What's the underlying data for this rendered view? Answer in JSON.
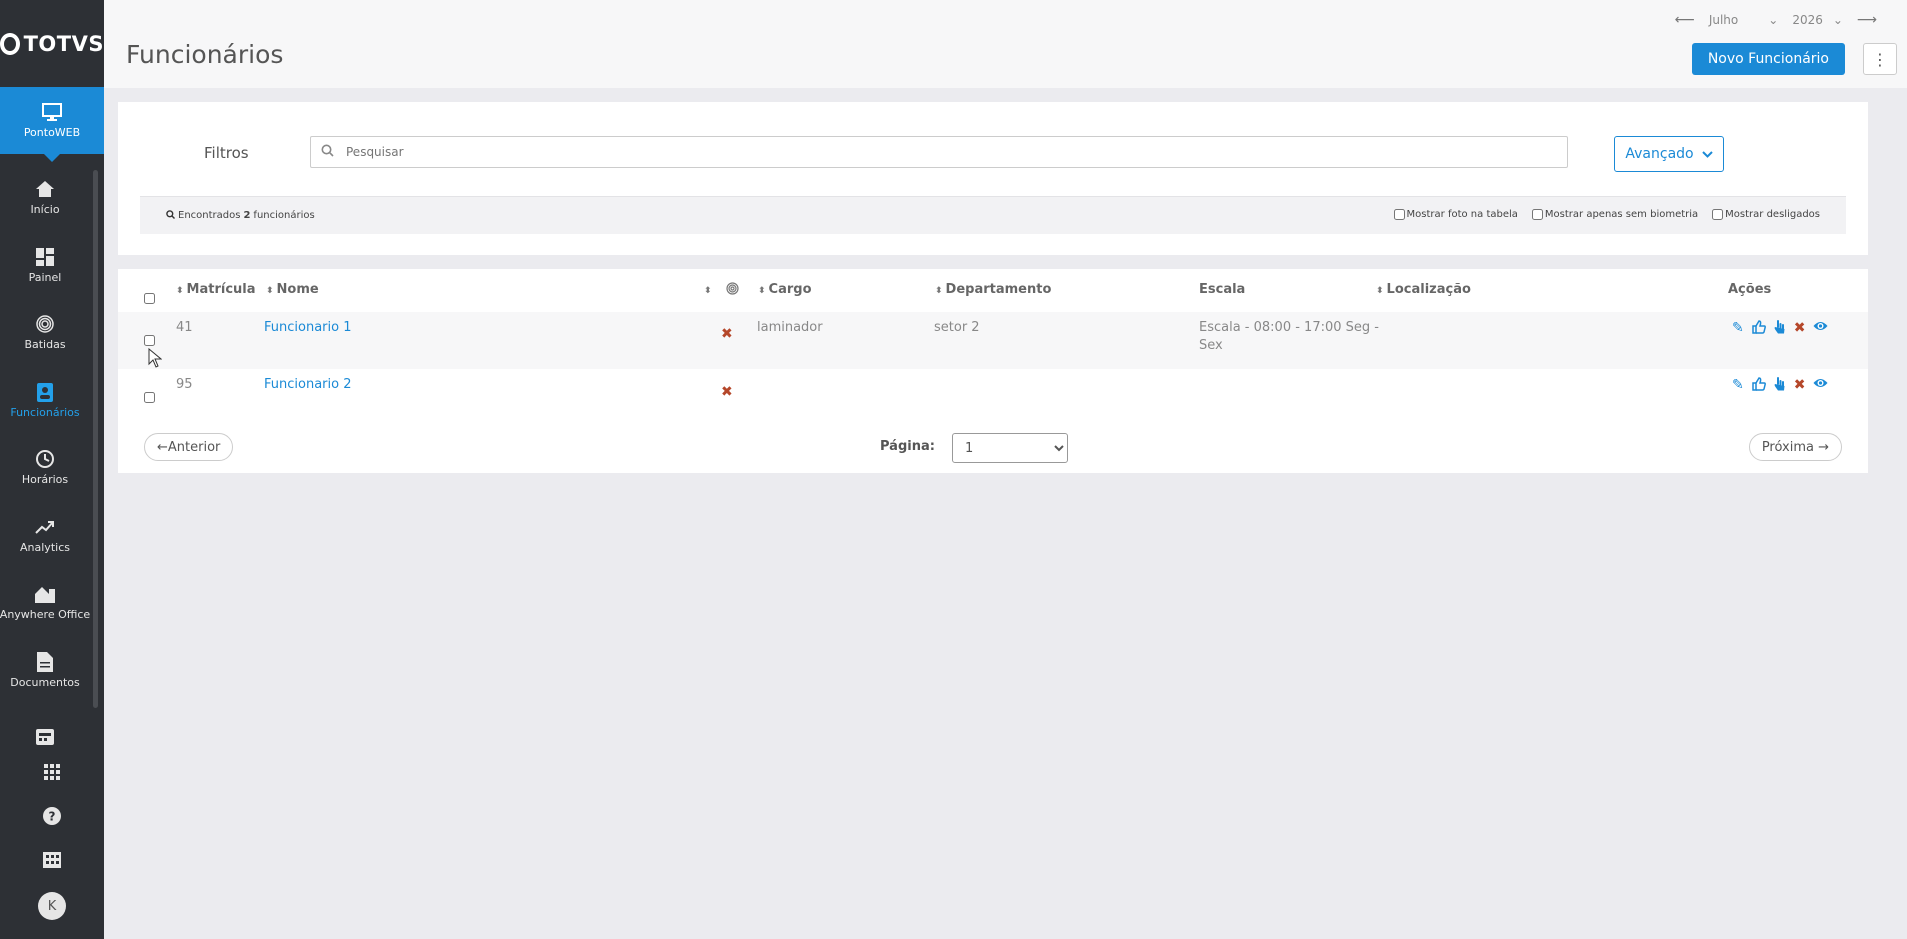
{
  "brand": {
    "logo_text": "TOTVS",
    "accent": "#1b8ad6"
  },
  "app": {
    "name": "PontoWEB"
  },
  "sidebar": {
    "items": [
      {
        "label": "Início",
        "icon": "home-icon",
        "active": false
      },
      {
        "label": "Painel",
        "icon": "dashboard-icon",
        "active": false
      },
      {
        "label": "Batidas",
        "icon": "fingerprint-icon",
        "active": false
      },
      {
        "label": "Funcionários",
        "icon": "employee-badge-icon",
        "active": true
      },
      {
        "label": "Horários",
        "icon": "clock-icon",
        "active": false
      },
      {
        "label": "Analytics",
        "icon": "trend-icon",
        "active": false
      },
      {
        "label": "Anywhere Office",
        "icon": "house-office-icon",
        "active": false
      },
      {
        "label": "Documentos",
        "icon": "document-icon",
        "active": false
      },
      {
        "label": "",
        "icon": "register-icon",
        "active": false
      }
    ],
    "bottom": [
      "apps-grid-icon",
      "help-icon",
      "building-icon"
    ],
    "avatar_initial": "K"
  },
  "header": {
    "title": "Funcionários",
    "month": "Julho",
    "year": "2026",
    "new_button": "Novo Funcionário"
  },
  "filters": {
    "title": "Filtros",
    "search_placeholder": "Pesquisar",
    "advanced_label": "Avançado",
    "found_prefix": "Encontrados",
    "found_count": "2",
    "found_suffix": "funcionários",
    "options": [
      "Mostrar foto na tabela",
      "Mostrar apenas sem biometria",
      "Mostrar desligados"
    ]
  },
  "table": {
    "columns": {
      "matricula": "Matrícula",
      "nome": "Nome",
      "cargo": "Cargo",
      "departamento": "Departamento",
      "escala": "Escala",
      "localizacao": "Localização",
      "acoes": "Ações"
    },
    "rows": [
      {
        "matricula": "41",
        "nome": "Funcionario 1",
        "cargo": "laminador",
        "departamento": "setor 2",
        "escala_line1": "Escala - 08:00 - 17:00 Seg -",
        "escala_line2": "Sex",
        "localizacao": ""
      },
      {
        "matricula": "95",
        "nome": "Funcionario 2",
        "cargo": "",
        "departamento": "",
        "escala_line1": "",
        "escala_line2": "",
        "localizacao": ""
      }
    ]
  },
  "pagination": {
    "prev_label": "←Anterior",
    "page_label": "Página:",
    "current_page": "1",
    "next_label": "Próxima →"
  }
}
